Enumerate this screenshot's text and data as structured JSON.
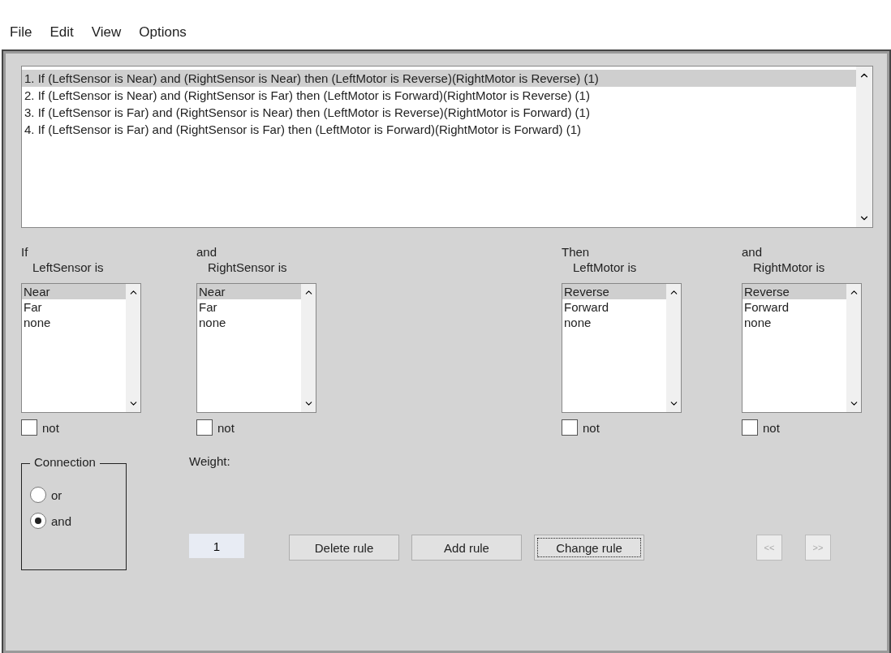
{
  "menu": [
    "File",
    "Edit",
    "View",
    "Options"
  ],
  "rules": [
    {
      "text": "1. If (LeftSensor is Near) and (RightSensor is Near) then (LeftMotor is Reverse)(RightMotor is Reverse) (1)",
      "selected": true
    },
    {
      "text": "2. If (LeftSensor is Near) and (RightSensor is Far) then (LeftMotor is Forward)(RightMotor is Reverse) (1)",
      "selected": false
    },
    {
      "text": "3. If (LeftSensor is Far) and (RightSensor is Near) then (LeftMotor is Reverse)(RightMotor is Forward) (1)",
      "selected": false
    },
    {
      "text": "4. If (LeftSensor is Far) and (RightSensor is Far) then (LeftMotor is Forward)(RightMotor is Forward) (1)",
      "selected": false
    }
  ],
  "variables": [
    {
      "connector": "If",
      "label": "LeftSensor is",
      "options": [
        {
          "text": "Near",
          "selected": true
        },
        {
          "text": "Far",
          "selected": false
        },
        {
          "text": "none",
          "selected": false
        }
      ],
      "not_label": "not",
      "not_checked": false
    },
    {
      "connector": "and",
      "label": "RightSensor is",
      "options": [
        {
          "text": "Near",
          "selected": true
        },
        {
          "text": "Far",
          "selected": false
        },
        {
          "text": "none",
          "selected": false
        }
      ],
      "not_label": "not",
      "not_checked": false
    },
    {
      "connector": "Then",
      "label": "LeftMotor is",
      "options": [
        {
          "text": "Reverse",
          "selected": true
        },
        {
          "text": "Forward",
          "selected": false
        },
        {
          "text": "none",
          "selected": false
        }
      ],
      "not_label": "not",
      "not_checked": false
    },
    {
      "connector": "and",
      "label": "RightMotor is",
      "options": [
        {
          "text": "Reverse",
          "selected": true
        },
        {
          "text": "Forward",
          "selected": false
        },
        {
          "text": "none",
          "selected": false
        }
      ],
      "not_label": "not",
      "not_checked": false
    }
  ],
  "connection": {
    "title": "Connection",
    "options": [
      {
        "label": "or",
        "selected": false
      },
      {
        "label": "and",
        "selected": true
      }
    ]
  },
  "weight": {
    "label": "Weight:",
    "value": "1"
  },
  "buttons": [
    {
      "label": "Delete rule",
      "focused": false
    },
    {
      "label": "Add rule",
      "focused": false
    },
    {
      "label": "Change rule",
      "focused": true
    }
  ],
  "nav_buttons": [
    {
      "label": "<<",
      "disabled": true
    },
    {
      "label": ">>",
      "disabled": true
    }
  ]
}
